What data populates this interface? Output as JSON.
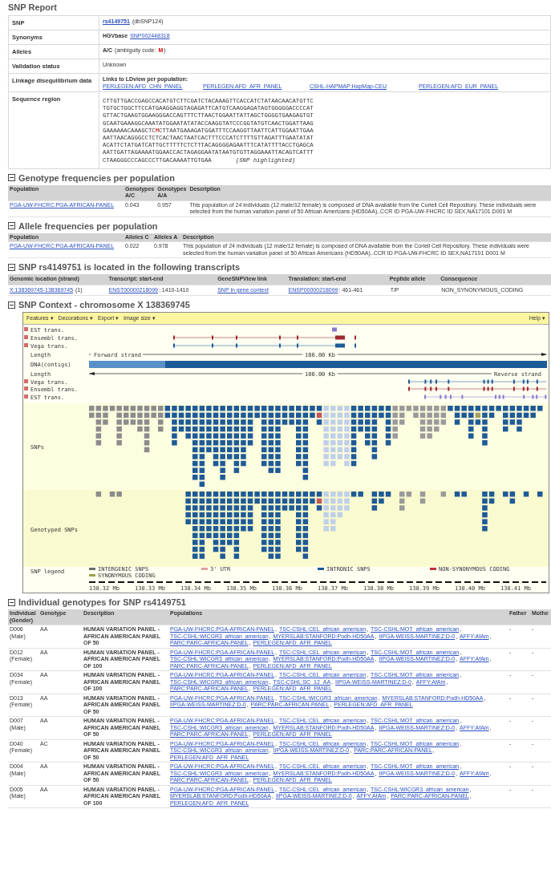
{
  "title": "SNP Report",
  "summary": [
    {
      "label": "SNP",
      "kind": "snp",
      "link": "rs4149751",
      "note": "(dbSNP124)"
    },
    {
      "label": "Synonyms",
      "kind": "synonym",
      "source": "HGVbase",
      "link": "SNP002448318"
    },
    {
      "label": "Alleles",
      "kind": "alleles",
      "alleles": "A/C",
      "note": "(ambiguity code:",
      "code": "M",
      "close": ")"
    },
    {
      "label": "Validation status",
      "kind": "text",
      "text": "Unknown"
    },
    {
      "label": "Linkage disequilibrium data",
      "kind": "ld",
      "heading": "Links to LDview per population:",
      "links": [
        "PERLEGEN:AFD_CHN_PANEL",
        "PERLEGEN:AFD_AFR_PANEL",
        "CSHL-HAPMAP:HapMap-CEU",
        "PERLEGEN:AFD_EUR_PANEL"
      ]
    },
    {
      "label": "Sequence region",
      "kind": "sequence",
      "note": "(SNP highlighted)",
      "lines": [
        {
          "text": "CTTGTTGACCGAGCCACATGTCTTCGATCTACAAAGTTCACCATCTATAACAACATGTTC"
        },
        {
          "text": "TGTGCTGGCTTCCATGAAGGAGGTAGAGATTCATGTCAAGGAGATAGTGGGGGACCCCAT"
        },
        {
          "text": "GTTACTGAAGTGGAAGGGACCAGTTTCTTAACTGGAATTATTAGCTGGGGTGAAGAGTGT"
        },
        {
          "text": "GCAATGAAAGGCAAATATGGAATATATACCAAGGTATCCCGGTATGTCAACTGGATTAAG"
        },
        {
          "text": "GAAAAAACAAAGCTC",
          "snp": "M",
          "post": "CTTAATGAAAGATGGATTTCCAAGGTTAATTCATTGGAATTGAA"
        },
        {
          "text": "AATTAACAGGGCCTCTCACTAACTAATCACTTTCCCATCTTTTGTTAGATTTGAATATAT"
        },
        {
          "text": "ACATTCTATGATCATTGCTTTTTCTCTTTACAGGGGAGAATTTCATATTTTACCTGAGCA"
        },
        {
          "text": "AATTGATTAGAAAATGGAACCACTAGAGGAATATAATGTGTTAGGAAATTACAGTCATTT"
        },
        {
          "text": "CTAAGGGCCCAGCCCTTGACAAAATTGTGAA"
        }
      ]
    }
  ],
  "genotype_frequencies": {
    "title": "Genotype frequencies per population",
    "columns": [
      "Population",
      "Genotypes A/C",
      "Genotypes A/A",
      "Description"
    ],
    "rows": [
      {
        "population": "PGA-UW-FHCRC:PGA-AFRICAN-PANEL",
        "values": [
          "0.043",
          "0.957"
        ],
        "description": "This population of 24 individuals (12 male/12 female) is composed of DNA available from the Coriell Cell Repository. These individuals were selected from the human variation panel of 50 African Americans (HD50AA)..CCR ID PGA-UW-FHCRC ID SEX,NA17101 D001 M"
      }
    ]
  },
  "allele_frequencies": {
    "title": "Allele frequencies per population",
    "columns": [
      "Population",
      "Alleles C",
      "Alleles A",
      "Description"
    ],
    "rows": [
      {
        "population": "PGA-UW-FHCRC:PGA-AFRICAN-PANEL",
        "values": [
          "0.022",
          "0.978"
        ],
        "description": "This population of 24 individuals (12 male/12 female) is composed of DNA available from the Coriell Cell Repository. These individuals were selected from the human variation panel of 50 African Americans (HD50AA)..CCR ID PGA-UW-FHCRC ID SEX,NA17101 D001 M"
      }
    ]
  },
  "transcripts": {
    "title": "SNP rs4149751 is located in the following transcripts",
    "columns": [
      "Genomic location (strand)",
      "Transcript: start-end",
      "GeneSNPView link",
      "Translation: start-end",
      "Peptide allele",
      "Consequence"
    ],
    "rows": [
      [
        {
          "link": "X:138369745-138369745",
          "text": " (1)"
        },
        {
          "link": "ENST00000218099",
          "text": ": 1410-1410"
        },
        {
          "link": "SNP in gene context"
        },
        {
          "link": "ENSP00000218099",
          "text": ": 461-461"
        },
        {
          "text": "T/P"
        },
        {
          "text": "NON_SYNONYMOUS_CODING"
        }
      ]
    ]
  },
  "context": {
    "title": "SNP Context - chromosome X 138369745",
    "menu": [
      "Features ▾",
      "Decorations ▾",
      "Export ▾",
      "Image size ▾"
    ],
    "help": "Help ▾",
    "tracks": [
      {
        "label": "EST trans.",
        "kind": "est"
      },
      {
        "label": "Ensembl trans.",
        "kind": "ensembl"
      },
      {
        "label": "Vega trans.",
        "kind": "vega"
      },
      {
        "label": "Length",
        "kind": "length",
        "end_label": "Forward strand",
        "length": "100.00 Kb"
      },
      {
        "label": "DNA(contigs)",
        "kind": "contig"
      },
      {
        "label": "Length",
        "kind": "length",
        "end_label": "Reverse strand",
        "length": "100.00 Kb"
      },
      {
        "label": "Vega trans.",
        "kind": "vega"
      },
      {
        "label": "Ensembl trans.",
        "kind": "ensembl"
      },
      {
        "label": "EST trans.",
        "kind": "est"
      }
    ],
    "snp_tracks": [
      "SNPs",
      "Genotyped SNPs"
    ],
    "legend_label": "SNP legend",
    "legend": [
      {
        "label": "INTERGENIC SNPS",
        "color": "#6e6e6e"
      },
      {
        "label": "SYNONYMOUS CODING",
        "color": "#a0a050"
      },
      {
        "label": "3' UTR",
        "color": "#e0a0a0"
      },
      {
        "label": "INTRONIC SNPS",
        "color": "#1e5a96"
      },
      {
        "label": "NON-SYNONYMOUS CODING",
        "color": "#c03040"
      }
    ],
    "axis_ticks": [
      "138.32 Mb",
      "138.33 Mb",
      "138.34 Mb",
      "138.35 Mb",
      "138.36 Mb",
      "138.37 Mb",
      "138.38 Mb",
      "138.39 Mb",
      "138.40 Mb",
      "138.41 Mb"
    ]
  },
  "individuals": {
    "title": "Individual genotypes for SNP rs4149751",
    "columns": [
      "Individual (Gender)",
      "Genotype",
      "Description",
      "Populations",
      "Father",
      "Mothe"
    ],
    "rows": [
      {
        "id": "D006",
        "gender": "(Male)",
        "genotype": "AA",
        "description": "HUMAN VARIATION PANEL - AFRICAN AMERICAN PANEL OF 50",
        "father": "-",
        "mother": "-",
        "populations": [
          {
            "name": "PGA-UW-FHCRC:PGA-AFRICAN-PANEL",
            "sep": ","
          },
          {
            "name": "TSC-CSHL:CEL_african_american",
            "sep": ","
          },
          {
            "name": "TSC-CSHL:MOT_african_american",
            "sep": ","
          },
          {
            "name": "TSC-CSHL:WICGR3_african_american",
            "sep": ","
          },
          {
            "name": "MYERSLAB:STANFORD:Podh-HD50AA",
            "sep": ","
          },
          {
            "name": "IIPGA-WEISS-MARTINEZ:D-0",
            "sep": ","
          },
          {
            "name": "AFFY:AfAm",
            "sep": ","
          },
          {
            "name": "PARC:PARC-AFRICAN-PANEL",
            "sep": ","
          },
          {
            "name": "PERLEGEN:AFD_AFR_PANEL"
          }
        ]
      },
      {
        "id": "D012",
        "gender": "(Female)",
        "genotype": "AA",
        "description": "HUMAN VARIATION PANEL - AFRICAN AMERICAN PANEL OF 100",
        "father": "-",
        "mother": "-",
        "populations": [
          {
            "name": "PGA-UW-FHCRC:PGA-AFRICAN-PANEL",
            "sep": ","
          },
          {
            "name": "TSC-CSHL:CEL_african_american",
            "sep": ","
          },
          {
            "name": "TSC-CSHL:MOT_african_american",
            "sep": ","
          },
          {
            "name": "TSC-CSHL:WICGR3_african_american",
            "sep": ","
          },
          {
            "name": "MYERSLAB:STANFORD:Podh-HD50AA",
            "sep": ","
          },
          {
            "name": "IIPGA-WEISS-MARTINEZ:D-0",
            "sep": ","
          },
          {
            "name": "AFFY:AfAm",
            "sep": ","
          },
          {
            "name": "PARC:PARC-AFRICAN-PANEL",
            "sep": ","
          },
          {
            "name": "PERLEGEN:AFD_AFR_PANEL"
          }
        ]
      },
      {
        "id": "D034",
        "gender": "(Female)",
        "genotype": "AA",
        "description": "HUMAN VARIATION PANEL - AFRICAN AMERICAN PANEL OF 100",
        "father": "-",
        "mother": "-",
        "populations": [
          {
            "name": "PGA-UW-FHCRC:PGA-AFRICAN-PANEL",
            "sep": ","
          },
          {
            "name": "TSC-CSHL:CEL_african_american",
            "sep": ","
          },
          {
            "name": "TSC-CSHL:MOT_african_american",
            "sep": ","
          },
          {
            "name": "TSC-CSHL:WICGR3_african_american",
            "sep": ","
          },
          {
            "name": "TSC-CSHL:SC_12_AA",
            "sep": ","
          },
          {
            "name": "IIPGA-WEISS-MARTINEZ:D-0",
            "sep": ","
          },
          {
            "name": "AFFY:AfAm",
            "sep": ","
          },
          {
            "name": "PARC:PARC-AFRICAN-PANEL",
            "sep": ","
          },
          {
            "name": "PERLEGEN:AFD_AFR_PANEL"
          }
        ]
      },
      {
        "id": "D013",
        "gender": "(Female)",
        "genotype": "AA",
        "description": "HUMAN VARIATION PANEL - AFRICAN AMERICAN PANEL OF 50",
        "father": "-",
        "mother": "-",
        "populations": [
          {
            "name": "PGA-UW-FHCRC:PGA-AFRICAN-PANEL",
            "sep": ","
          },
          {
            "name": "TSC-CSHL:WICGR3_african_american",
            "sep": ","
          },
          {
            "name": "MYERSLAB:STANFORD:Podh-HD50AA",
            "sep": ","
          },
          {
            "name": "IIPGA-WEISS-MARTINEZ:D-0",
            "sep": ","
          },
          {
            "name": "PARC:PARC-AFRICAN-PANEL",
            "sep": ","
          },
          {
            "name": "PERLEGEN:AFD_AFR_PANEL"
          }
        ]
      },
      {
        "id": "D007",
        "gender": "(Male)",
        "genotype": "AA",
        "description": "HUMAN VARIATION PANEL - AFRICAN AMERICAN PANEL OF 50",
        "father": "-",
        "mother": "-",
        "populations": [
          {
            "name": "PGA-UW-FHCRC:PGA-AFRICAN-PANEL",
            "sep": ","
          },
          {
            "name": "TSC-CSHL:CEL_african_american",
            "sep": ","
          },
          {
            "name": "TSC-CSHL:MOT_african_american",
            "sep": ","
          },
          {
            "name": "TSC-CSHL:WICGR3_african_american",
            "sep": ","
          },
          {
            "name": "MYERSLAB:STANFORD:Podh-HD50AA",
            "sep": ","
          },
          {
            "name": "IIPGA-WEISS-MARTINEZ:D-0",
            "sep": ","
          },
          {
            "name": "AFFY:AfAm",
            "sep": ","
          },
          {
            "name": "PARC:PARC-AFRICAN-PANEL",
            "sep": ","
          },
          {
            "name": "PERLEGEN:AFD_AFR_PANEL"
          }
        ]
      },
      {
        "id": "D040",
        "gender": "(Female)",
        "genotype": "AC",
        "description": "HUMAN VARIATION PANEL - AFRICAN AMERICAN PANEL OF 50",
        "father": "-",
        "mother": "-",
        "populations": [
          {
            "name": "PGA-UW-FHCRC:PGA-AFRICAN-PANEL",
            "sep": ","
          },
          {
            "name": "TSC-CSHL:CEL_african_american",
            "sep": ","
          },
          {
            "name": "TSC-CSHL:MOT_african_american",
            "sep": ","
          },
          {
            "name": "TSC-CSHL:WICGR3_african_american",
            "sep": ","
          },
          {
            "name": "IIPGA-WEISS-MARTINEZ:D-0",
            "sep": ","
          },
          {
            "name": "PARC:PARC-AFRICAN-PANEL",
            "sep": ","
          },
          {
            "name": "PERLEGEN:AFD_AFR_PANEL"
          }
        ]
      },
      {
        "id": "D004",
        "gender": "(Male)",
        "genotype": "AA",
        "description": "HUMAN VARIATION PANEL - AFRICAN AMERICAN PANEL OF 50",
        "father": "-",
        "mother": "-",
        "populations": [
          {
            "name": "PGA-UW-FHCRC:PGA-AFRICAN-PANEL",
            "sep": ","
          },
          {
            "name": "TSC-CSHL:CEL_african_american",
            "sep": ","
          },
          {
            "name": "TSC-CSHL:MOT_african_american",
            "sep": ","
          },
          {
            "name": "TSC-CSHL:WICGR3_african_american",
            "sep": ","
          },
          {
            "name": "MYERSLAB:STANFORD:Podh-HD50AA",
            "sep": ","
          },
          {
            "name": "IIPGA-WEISS-MARTINEZ:D-0",
            "sep": ","
          },
          {
            "name": "AFFY:AfAm",
            "sep": ","
          },
          {
            "name": "PARC:PARC-AFRICAN-PANEL",
            "sep": ","
          },
          {
            "name": "PERLEGEN:AFD_AFR_PANEL"
          }
        ]
      },
      {
        "id": "D005",
        "gender": "(Male)",
        "genotype": "AA",
        "description": "HUMAN VARIATION PANEL - AFRICAN AMERICAN PANEL OF 100",
        "father": "-",
        "mother": "-",
        "populations": [
          {
            "name": "PGA-UW-FHCRC:PGA-AFRICAN-PANEL",
            "sep": ","
          },
          {
            "name": "TSC-CSHL:CEL_african_american",
            "sep": ","
          },
          {
            "name": "TSC-CSHL:WICGR3_african_american",
            "sep": ","
          },
          {
            "name": "MYERSLAB:STANFORD:Podh-HD50AA",
            "sep": ","
          },
          {
            "name": "IIPGA-WEISS-MARTINEZ:D-0",
            "sep": ","
          },
          {
            "name": "AFFY:AfAm",
            "sep": ","
          },
          {
            "name": "PARC:PARC-AFRICAN-PANEL",
            "sep": ","
          },
          {
            "name": "PERLEGEN:AFD_AFR_PANEL"
          }
        ]
      }
    ]
  }
}
